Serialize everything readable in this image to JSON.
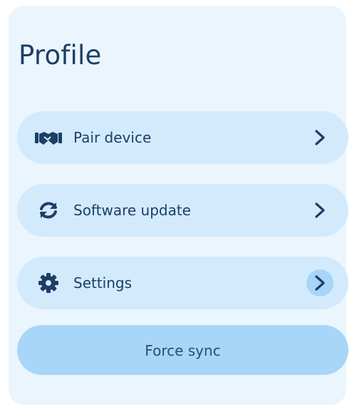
{
  "profile": {
    "title": "Profile"
  },
  "menu": {
    "items": [
      {
        "label": "Pair device",
        "icon": "handshake-icon"
      },
      {
        "label": "Software update",
        "icon": "sync-icon"
      },
      {
        "label": "Settings",
        "icon": "gear-icon"
      }
    ]
  },
  "actions": {
    "force_sync_label": "Force sync"
  },
  "colors": {
    "card_background": "#eaf5fe",
    "item_background": "#d3eafd",
    "primary_button": "#a7d6f8",
    "text": "#1d3f66",
    "chevron_hover": "#a7d4f7"
  }
}
